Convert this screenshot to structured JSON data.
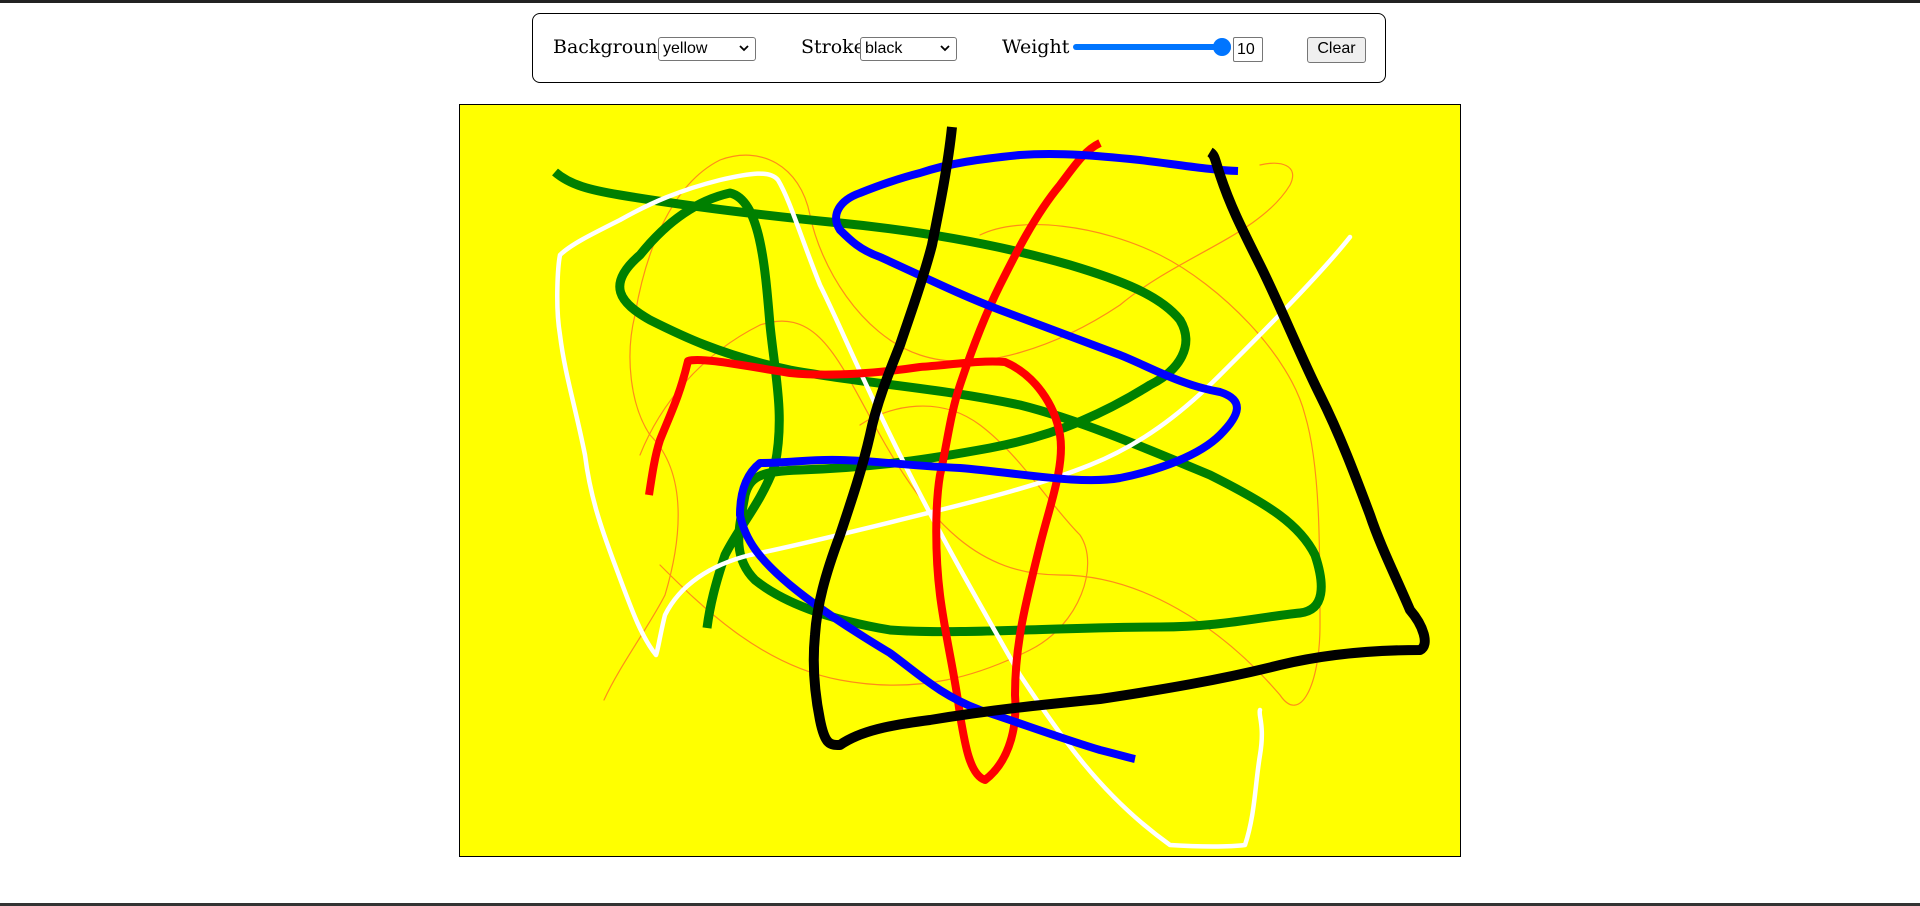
{
  "toolbar": {
    "background_label": "Background",
    "background_value": "yellow",
    "stroke_label": "Stroke",
    "stroke_value": "black",
    "weight_label": "Weight",
    "weight_value": "10",
    "weight_level": 10,
    "weight_max": 10,
    "weight_min": 1,
    "clear_label": "Clear"
  },
  "canvas": {
    "background_color": "#ffff00",
    "strokes": [
      {
        "name": "thin-orange",
        "color": "#ff8c1a"
      },
      {
        "name": "green",
        "color": "#008000"
      },
      {
        "name": "white",
        "color": "#ffffff"
      },
      {
        "name": "red",
        "color": "#ff0000"
      },
      {
        "name": "blue",
        "color": "#0000ff"
      },
      {
        "name": "black",
        "color": "#000000"
      }
    ]
  },
  "icons": {
    "select_chevron": "chevron-down-icon"
  }
}
